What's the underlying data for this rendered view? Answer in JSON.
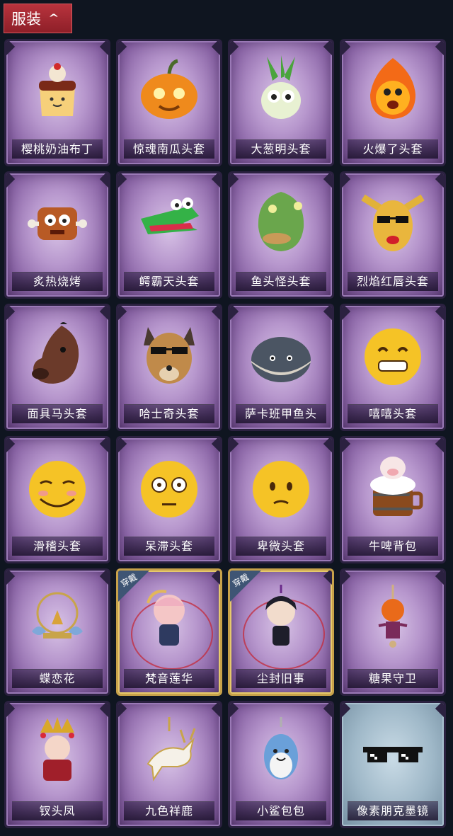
{
  "header": {
    "title": "服装",
    "chevron_icon": "chevron-up-icon"
  },
  "equipped_tag": "穿戴",
  "items": [
    {
      "name": "樱桃奶油布丁",
      "icon": "pudding-icon",
      "equipped": false
    },
    {
      "name": "惊魂南瓜头套",
      "icon": "pumpkin-icon",
      "equipped": false
    },
    {
      "name": "大葱明头套",
      "icon": "green-onion-icon",
      "equipped": false
    },
    {
      "name": "火爆了头套",
      "icon": "fire-spirit-icon",
      "equipped": false
    },
    {
      "name": "炙热烧烤",
      "icon": "meat-bone-icon",
      "equipped": false
    },
    {
      "name": "鳄霸天头套",
      "icon": "crocodile-icon",
      "equipped": false
    },
    {
      "name": "鱼头怪头套",
      "icon": "fish-head-icon",
      "equipped": false
    },
    {
      "name": "烈焰红唇头套",
      "icon": "yellow-mask-sunglasses-icon",
      "equipped": false
    },
    {
      "name": "面具马头套",
      "icon": "horse-head-icon",
      "equipped": false
    },
    {
      "name": "哈士奇头套",
      "icon": "husky-head-icon",
      "equipped": false
    },
    {
      "name": "萨卡班甲鱼头",
      "icon": "sacabambaspis-icon",
      "equipped": false
    },
    {
      "name": "嘻嘻头套",
      "icon": "grinning-emoji-icon",
      "equipped": false
    },
    {
      "name": "滑稽头套",
      "icon": "funny-emoji-icon",
      "equipped": false
    },
    {
      "name": "呆滞头套",
      "icon": "flushed-emoji-icon",
      "equipped": false
    },
    {
      "name": "卑微头套",
      "icon": "pleading-emoji-icon",
      "equipped": false
    },
    {
      "name": "牛啤背包",
      "icon": "cow-beer-barrel-icon",
      "equipped": false
    },
    {
      "name": "蝶恋花",
      "icon": "butterfly-bell-ornament-icon",
      "equipped": false
    },
    {
      "name": "梵音莲华",
      "icon": "lotus-charm-figure-icon",
      "equipped": true
    },
    {
      "name": "尘封旧事",
      "icon": "dark-hair-charm-figure-icon",
      "equipped": true
    },
    {
      "name": "糖果守卫",
      "icon": "pumpkin-guard-charm-icon",
      "equipped": false
    },
    {
      "name": "钗头凤",
      "icon": "phoenix-crown-figure-icon",
      "equipped": false
    },
    {
      "name": "九色祥鹿",
      "icon": "deer-charm-icon",
      "equipped": false
    },
    {
      "name": "小鲨包包",
      "icon": "shark-charm-icon",
      "equipped": false
    },
    {
      "name": "像素朋克墨镜",
      "icon": "pixel-sunglasses-icon",
      "equipped": false
    }
  ]
}
